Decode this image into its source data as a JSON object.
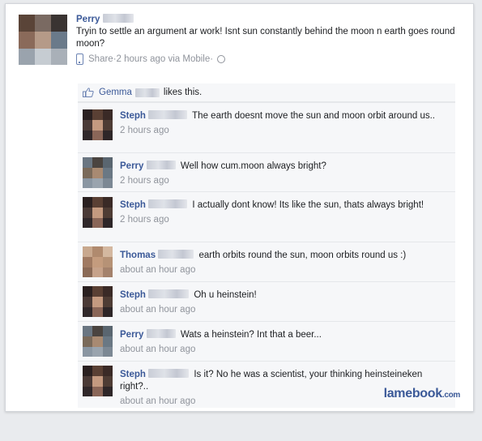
{
  "post": {
    "author": "Perry",
    "text": "Tryin to settle an argument ar work! Isnt sun constantly behind the moon n earth goes round moon?",
    "share_label": "Share",
    "meta_sep1": " · ",
    "time": "2 hours ago via Mobile",
    "meta_sep2": " · "
  },
  "likes": {
    "name": "Gemma",
    "suffix": "likes this."
  },
  "comments": [
    {
      "author": "Steph",
      "text": "The earth doesnt move the sun and moon orbit around us..",
      "time": "2 hours ago"
    },
    {
      "author": "Perry",
      "text": "Well how cum.moon always bright?",
      "time": "2 hours ago"
    },
    {
      "author": "Steph",
      "text": "I actually dont know! Its like the sun, thats always bright!",
      "time": "2 hours ago"
    },
    {
      "author": "Thomas",
      "text": "earth orbits round the sun, moon orbits round us :)",
      "time": "about an hour ago"
    },
    {
      "author": "Steph",
      "text": "Oh u heinstein!",
      "time": "about an hour ago"
    },
    {
      "author": "Perry",
      "text": "Wats a heinstein? Int that a beer...",
      "time": "about an hour ago"
    },
    {
      "author": "Steph",
      "text": "Is it? No he was a scientist, your thinking heinsteineken right?..",
      "time": "about an hour ago"
    }
  ],
  "watermark": {
    "brand": "lamebook",
    "tld": ".com"
  },
  "colors": {
    "link": "#3b5998",
    "meta": "#90949c",
    "comment_bg": "#f6f7f9"
  }
}
